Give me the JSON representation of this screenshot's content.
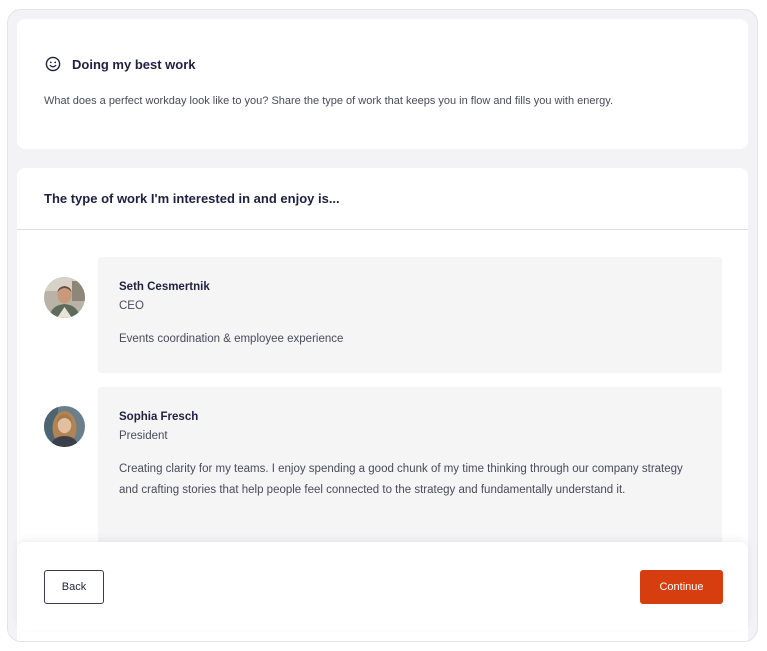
{
  "intro": {
    "icon": "smile-icon",
    "title": "Doing my best work",
    "description": "What does a perfect workday look like to you? Share the type of work that keeps you in flow and fills you with energy."
  },
  "section": {
    "title": "The type of work I'm interested in and enjoy is..."
  },
  "responses": [
    {
      "name": "Seth Cesmertnik",
      "role": "CEO",
      "text": "Events coordination & employee experience"
    },
    {
      "name": "Sophia Fresch",
      "role": "President",
      "text": "Creating clarity for my teams. I enjoy spending a good chunk of my time thinking through our company strategy and crafting stories that help people feel connected to the strategy and fundamentally understand it."
    }
  ],
  "footer": {
    "back_label": "Back",
    "continue_label": "Continue"
  },
  "colors": {
    "accent": "#d63d0f",
    "text": "#1f2040",
    "muted": "#4a4a5c",
    "response_bg": "#f5f5f6"
  }
}
